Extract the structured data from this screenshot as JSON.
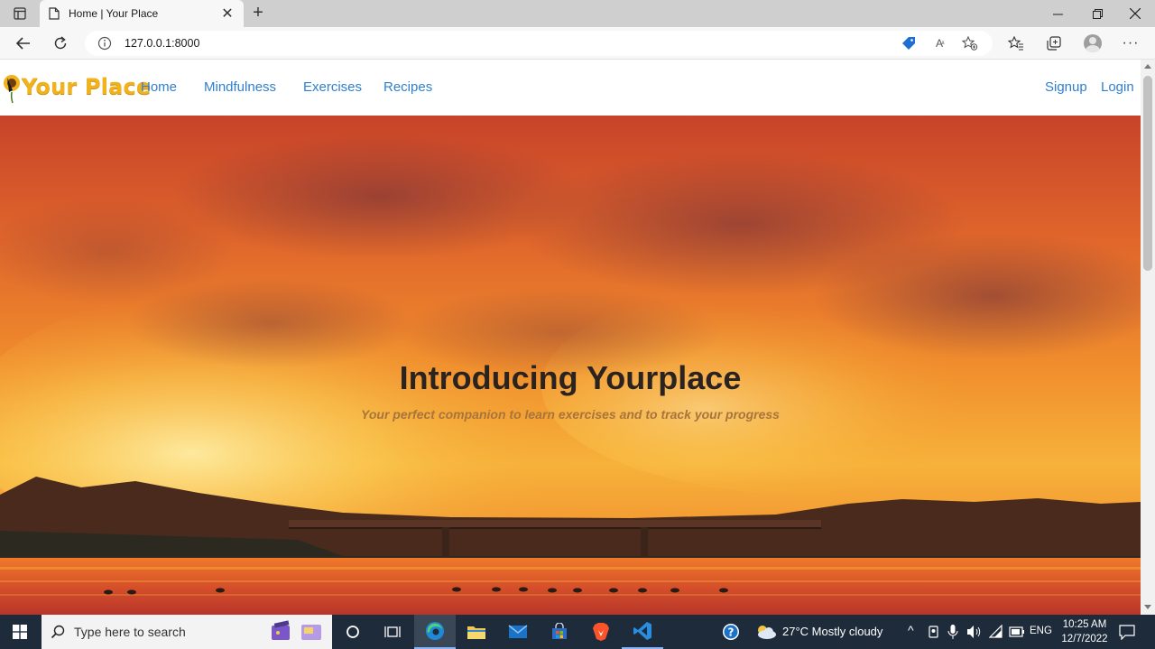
{
  "browser": {
    "tab_title": "Home | Your Place",
    "url": "127.0.0.1:8000"
  },
  "site": {
    "brand": "Your Place",
    "nav_left": [
      "Home",
      "Mindfulness",
      "Exercises",
      "Recipes"
    ],
    "nav_right": [
      "Signup",
      "Login"
    ],
    "hero_title": "Introducing Yourplace",
    "hero_subtitle": "Your perfect companion to learn exercises and to track your progress"
  },
  "taskbar": {
    "search_placeholder": "Type here to search",
    "weather": "27°C  Mostly cloudy",
    "language": "ENG",
    "time": "10:25 AM",
    "date": "12/7/2022"
  },
  "colors": {
    "nav_link": "#2f7fd1",
    "brand": "#f2b21c",
    "taskbar": "#1e2b3a"
  }
}
